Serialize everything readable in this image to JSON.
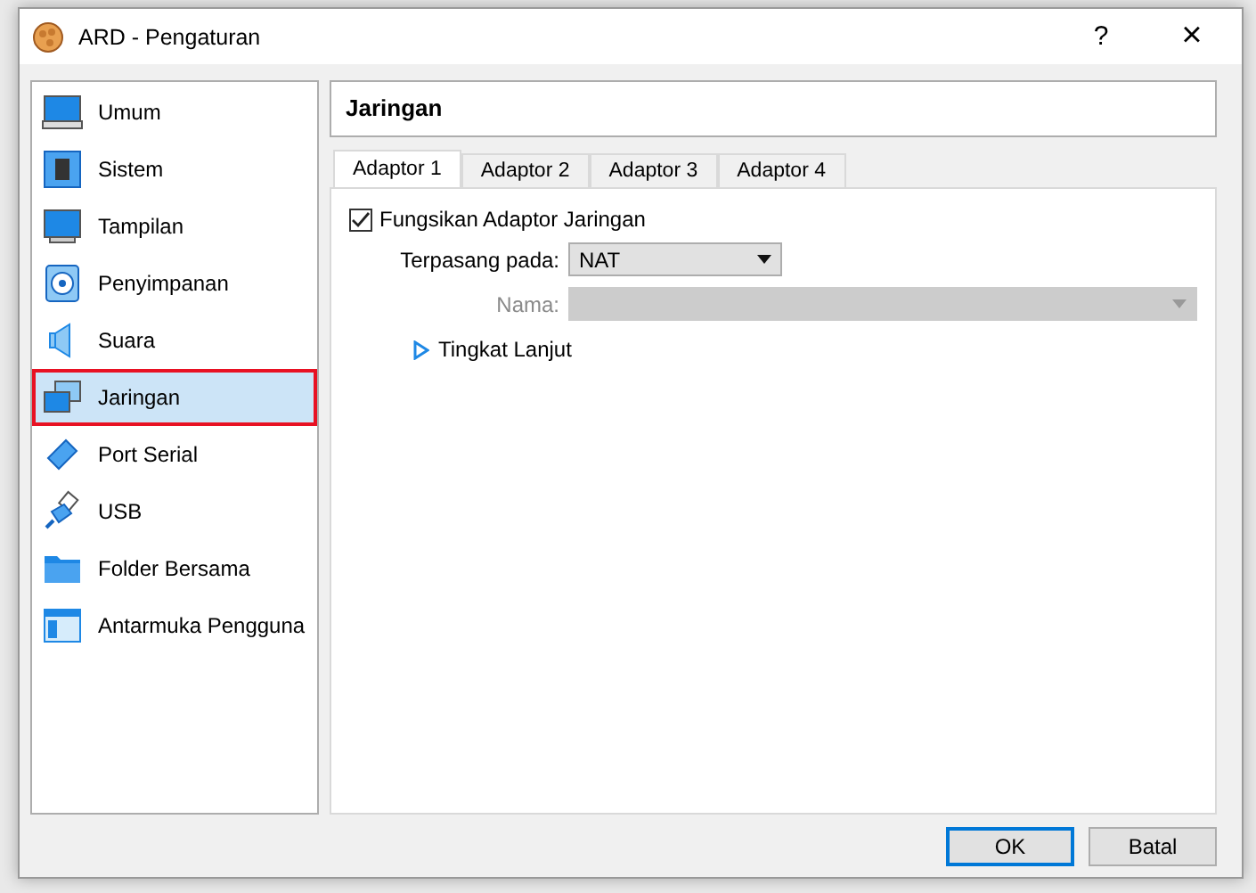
{
  "window": {
    "title": "ARD - Pengaturan",
    "help": "?",
    "close": "×"
  },
  "sidebar": {
    "items": [
      {
        "label": "Umum",
        "selected": false
      },
      {
        "label": "Sistem",
        "selected": false
      },
      {
        "label": "Tampilan",
        "selected": false
      },
      {
        "label": "Penyimpanan",
        "selected": false
      },
      {
        "label": "Suara",
        "selected": false
      },
      {
        "label": "Jaringan",
        "selected": true
      },
      {
        "label": "Port Serial",
        "selected": false
      },
      {
        "label": "USB",
        "selected": false
      },
      {
        "label": "Folder Bersama",
        "selected": false
      },
      {
        "label": "Antarmuka Pengguna",
        "selected": false
      }
    ]
  },
  "page": {
    "title": "Jaringan",
    "tabs": [
      {
        "label": "Adaptor 1",
        "selected": true
      },
      {
        "label": "Adaptor 2",
        "selected": false
      },
      {
        "label": "Adaptor 3",
        "selected": false
      },
      {
        "label": "Adaptor 4",
        "selected": false
      }
    ],
    "enable": {
      "label": "Fungsikan Adaptor Jaringan",
      "checked": true
    },
    "fields": [
      {
        "label": "Terpasang pada:",
        "value": "NAT",
        "disabled": false
      },
      {
        "label": "Nama:",
        "disabled": true
      }
    ],
    "advanced": {
      "label": "Tingkat Lanjut",
      "expanded": false
    }
  },
  "buttons": [
    {
      "label": "OK",
      "default": true
    },
    {
      "label": "Batal",
      "default": false
    }
  ]
}
